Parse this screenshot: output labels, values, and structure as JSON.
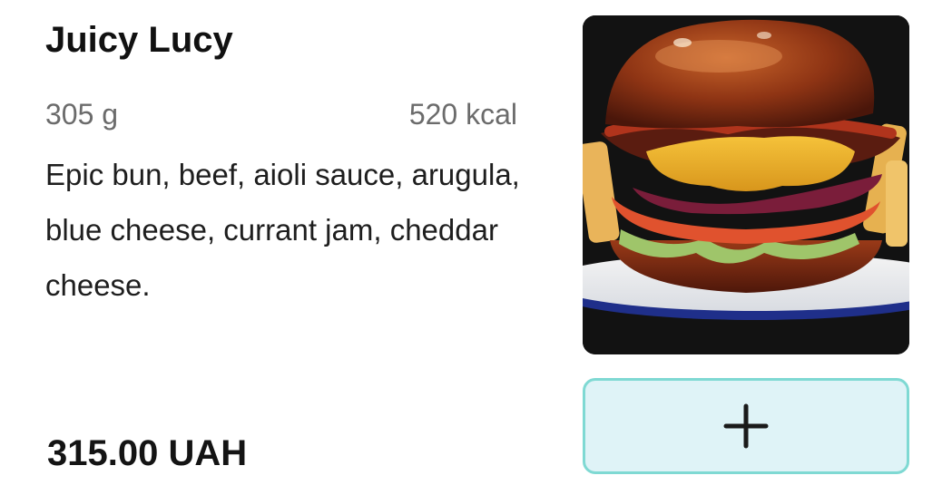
{
  "item": {
    "name": "Juicy Lucy",
    "weight": "305 g",
    "calories": "520 kcal",
    "description": "Epic bun, beef, aioli sauce, arugula, blue cheese, currant jam, cheddar cheese.",
    "price": "315.00 UAH",
    "image_icon": "burger-photo"
  },
  "actions": {
    "add_icon": "plus-icon"
  },
  "colors": {
    "button_bg": "#dff3f7",
    "button_border": "#7fd9d3",
    "text_primary": "#111111",
    "text_muted": "#6b6b6b"
  }
}
